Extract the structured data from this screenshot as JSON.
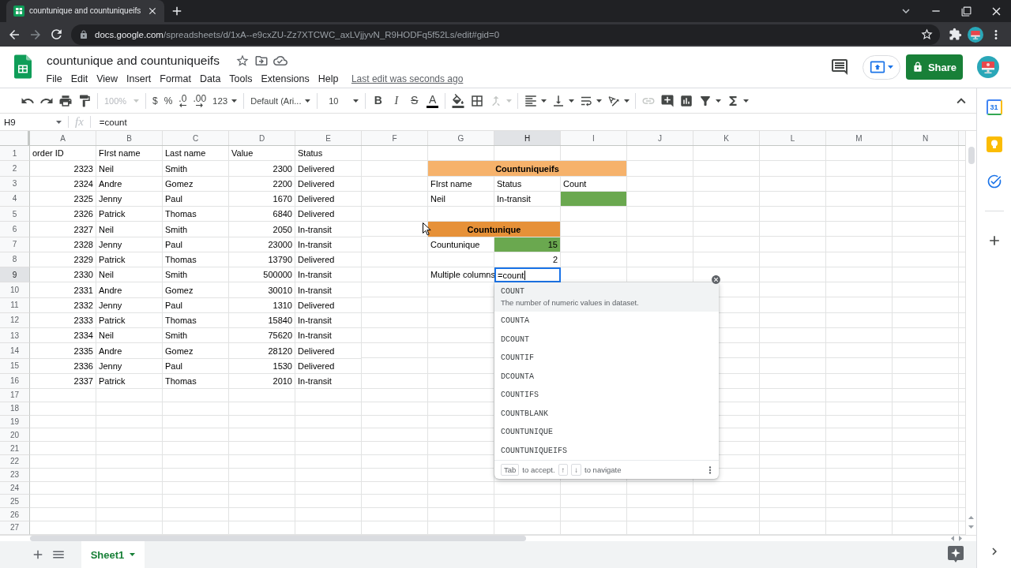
{
  "browser": {
    "tab": {
      "title": "countunique and countuniqueifs"
    },
    "url": {
      "host": "docs.google.com",
      "path": "/spreadsheets/d/1xA--e9cxZU-Zz7XTCWC_axLVjjyvN_R9HODFq5f52Ls/edit#gid=0"
    }
  },
  "document": {
    "title": "countunique and countuniqueifs",
    "menu": [
      "File",
      "Edit",
      "View",
      "Insert",
      "Format",
      "Data",
      "Tools",
      "Extensions",
      "Help"
    ],
    "last_edit": "Last edit was seconds ago",
    "share_button": "Share"
  },
  "toolbar": {
    "zoom": {
      "label": "100%",
      "disabled": true
    },
    "number_formats": [
      {
        "label": "$",
        "kind": "plain"
      },
      {
        "label": "%",
        "kind": "plain"
      },
      {
        "label": ".0",
        "kind": "decrease"
      },
      {
        "label": ".00",
        "kind": "increase"
      },
      {
        "label": "123",
        "kind": "menu"
      }
    ],
    "font": "Default (Ari...",
    "font_size": "10",
    "text_styles": [
      {
        "label": "B",
        "kind": "bold"
      },
      {
        "label": "I",
        "kind": "italic"
      },
      {
        "label": "S",
        "kind": "strike"
      },
      {
        "label": "A",
        "kind": "color"
      }
    ]
  },
  "formula_bar": {
    "cell_ref": "H9",
    "fx": "fx",
    "formula": "=count"
  },
  "sheet": {
    "columns": [
      {
        "label": "A",
        "selected": false
      },
      {
        "label": "B",
        "selected": false
      },
      {
        "label": "C",
        "selected": false
      },
      {
        "label": "D",
        "selected": false
      },
      {
        "label": "E",
        "selected": false
      },
      {
        "label": "F",
        "selected": false
      },
      {
        "label": "G",
        "selected": false
      },
      {
        "label": "H",
        "selected": true
      },
      {
        "label": "I",
        "selected": false
      },
      {
        "label": "J",
        "selected": false
      },
      {
        "label": "K",
        "selected": false
      },
      {
        "label": "L",
        "selected": false
      },
      {
        "label": "M",
        "selected": false
      },
      {
        "label": "N",
        "selected": false
      }
    ],
    "rows": [
      {
        "number": "1",
        "selected": false,
        "cells": [
          {
            "kind": "text",
            "text": "order ID"
          },
          {
            "kind": "text",
            "text": "FIrst name"
          },
          {
            "kind": "text",
            "text": "Last name"
          },
          {
            "kind": "text",
            "text": "Value"
          },
          {
            "kind": "text",
            "text": "Status"
          }
        ]
      },
      {
        "number": "2",
        "selected": false,
        "cells": [
          {
            "kind": "number",
            "text": "2323"
          },
          {
            "kind": "text",
            "text": "Neil"
          },
          {
            "kind": "text",
            "text": "Smith"
          },
          {
            "kind": "number",
            "text": "2300"
          },
          {
            "kind": "text",
            "text": "Delivered"
          },
          {
            "kind": "blank"
          },
          {
            "kind": "heading",
            "text": "Countuniqueifs",
            "color": "#f6b26b"
          },
          {
            "kind": "merged"
          },
          {
            "kind": "merged"
          }
        ]
      },
      {
        "number": "3",
        "selected": false,
        "cells": [
          {
            "kind": "number",
            "text": "2324"
          },
          {
            "kind": "text",
            "text": "Andre"
          },
          {
            "kind": "text",
            "text": "Gomez"
          },
          {
            "kind": "number",
            "text": "2200"
          },
          {
            "kind": "text",
            "text": "Delivered"
          },
          {
            "kind": "blank"
          },
          {
            "kind": "text",
            "text": "FIrst name"
          },
          {
            "kind": "text",
            "text": "Status"
          },
          {
            "kind": "text",
            "text": "Count"
          }
        ]
      },
      {
        "number": "4",
        "selected": false,
        "cells": [
          {
            "kind": "number",
            "text": "2325"
          },
          {
            "kind": "text",
            "text": "Jenny"
          },
          {
            "kind": "text",
            "text": "Paul"
          },
          {
            "kind": "number",
            "text": "1670"
          },
          {
            "kind": "text",
            "text": "Delivered"
          },
          {
            "kind": "blank"
          },
          {
            "kind": "text",
            "text": "Neil"
          },
          {
            "kind": "text",
            "text": "In-transit"
          },
          {
            "kind": "fill",
            "color": "#6aa84f"
          }
        ]
      },
      {
        "number": "5",
        "selected": false,
        "cells": [
          {
            "kind": "number",
            "text": "2326"
          },
          {
            "kind": "text",
            "text": "Patrick"
          },
          {
            "kind": "text",
            "text": "Thomas"
          },
          {
            "kind": "number",
            "text": "6840"
          },
          {
            "kind": "text",
            "text": "Delivered"
          }
        ]
      },
      {
        "number": "6",
        "selected": false,
        "cells": [
          {
            "kind": "number",
            "text": "2327"
          },
          {
            "kind": "text",
            "text": "Neil"
          },
          {
            "kind": "text",
            "text": "Smith"
          },
          {
            "kind": "number",
            "text": "2050"
          },
          {
            "kind": "text",
            "text": "In-transit"
          },
          {
            "kind": "blank"
          },
          {
            "kind": "heading",
            "text": "Countunique",
            "color": "#e69138"
          },
          {
            "kind": "merged"
          }
        ]
      },
      {
        "number": "7",
        "selected": false,
        "cells": [
          {
            "kind": "number",
            "text": "2328"
          },
          {
            "kind": "text",
            "text": "Jenny"
          },
          {
            "kind": "text",
            "text": "Paul"
          },
          {
            "kind": "number",
            "text": "23000"
          },
          {
            "kind": "text",
            "text": "In-transit"
          },
          {
            "kind": "blank"
          },
          {
            "kind": "text",
            "text": "Countunique"
          },
          {
            "kind": "number",
            "text": "15",
            "color": "#6aa84f"
          }
        ]
      },
      {
        "number": "8",
        "selected": false,
        "cells": [
          {
            "kind": "number",
            "text": "2329"
          },
          {
            "kind": "text",
            "text": "Patrick"
          },
          {
            "kind": "text",
            "text": "Thomas"
          },
          {
            "kind": "number",
            "text": "13790"
          },
          {
            "kind": "text",
            "text": "Delivered"
          },
          {
            "kind": "blank"
          },
          {
            "kind": "blank"
          },
          {
            "kind": "number",
            "text": "2"
          }
        ]
      },
      {
        "number": "9",
        "selected": true,
        "cells": [
          {
            "kind": "number",
            "text": "2330"
          },
          {
            "kind": "text",
            "text": "Neil"
          },
          {
            "kind": "text",
            "text": "Smith"
          },
          {
            "kind": "number",
            "text": "500000"
          },
          {
            "kind": "text",
            "text": "In-transit"
          },
          {
            "kind": "blank"
          },
          {
            "kind": "text",
            "text": "Multiple columns"
          },
          {
            "kind": "editor",
            "text": "=count"
          }
        ]
      },
      {
        "number": "10",
        "selected": false,
        "cells": [
          {
            "kind": "number",
            "text": "2331"
          },
          {
            "kind": "text",
            "text": "Andre"
          },
          {
            "kind": "text",
            "text": "Gomez"
          },
          {
            "kind": "number",
            "text": "30010"
          },
          {
            "kind": "text",
            "text": "In-transit"
          }
        ]
      },
      {
        "number": "11",
        "selected": false,
        "cells": [
          {
            "kind": "number",
            "text": "2332"
          },
          {
            "kind": "text",
            "text": "Jenny"
          },
          {
            "kind": "text",
            "text": "Paul"
          },
          {
            "kind": "number",
            "text": "1310"
          },
          {
            "kind": "text",
            "text": "Delivered"
          }
        ]
      },
      {
        "number": "12",
        "selected": false,
        "cells": [
          {
            "kind": "number",
            "text": "2333"
          },
          {
            "kind": "text",
            "text": "Patrick"
          },
          {
            "kind": "text",
            "text": "Thomas"
          },
          {
            "kind": "number",
            "text": "15840"
          },
          {
            "kind": "text",
            "text": "In-transit"
          }
        ]
      },
      {
        "number": "13",
        "selected": false,
        "cells": [
          {
            "kind": "number",
            "text": "2334"
          },
          {
            "kind": "text",
            "text": "Neil"
          },
          {
            "kind": "text",
            "text": "Smith"
          },
          {
            "kind": "number",
            "text": "75620"
          },
          {
            "kind": "text",
            "text": "In-transit"
          }
        ]
      },
      {
        "number": "14",
        "selected": false,
        "cells": [
          {
            "kind": "number",
            "text": "2335"
          },
          {
            "kind": "text",
            "text": "Andre"
          },
          {
            "kind": "text",
            "text": "Gomez"
          },
          {
            "kind": "number",
            "text": "28120"
          },
          {
            "kind": "text",
            "text": "Delivered"
          }
        ]
      },
      {
        "number": "15",
        "selected": false,
        "cells": [
          {
            "kind": "number",
            "text": "2336"
          },
          {
            "kind": "text",
            "text": "Jenny"
          },
          {
            "kind": "text",
            "text": "Paul"
          },
          {
            "kind": "number",
            "text": "1530"
          },
          {
            "kind": "text",
            "text": "Delivered"
          }
        ]
      },
      {
        "number": "16",
        "selected": false,
        "cells": [
          {
            "kind": "number",
            "text": "2337"
          },
          {
            "kind": "text",
            "text": "Patrick"
          },
          {
            "kind": "text",
            "text": "Thomas"
          },
          {
            "kind": "number",
            "text": "2010"
          },
          {
            "kind": "text",
            "text": "In-transit"
          }
        ]
      },
      {
        "number": "17",
        "selected": false
      },
      {
        "number": "18",
        "selected": false
      },
      {
        "number": "19",
        "selected": false
      },
      {
        "number": "20",
        "selected": false
      },
      {
        "number": "21",
        "selected": false
      },
      {
        "number": "22",
        "selected": false
      },
      {
        "number": "23",
        "selected": false
      },
      {
        "number": "24",
        "selected": false
      },
      {
        "number": "25",
        "selected": false
      },
      {
        "number": "26",
        "selected": false
      },
      {
        "number": "27",
        "selected": false
      }
    ]
  },
  "autocomplete": {
    "items": [
      {
        "name": "COUNT",
        "description": "The number of numeric values in dataset.",
        "selected": true
      },
      {
        "name": "COUNTA",
        "selected": false
      },
      {
        "name": "DCOUNT",
        "selected": false
      },
      {
        "name": "COUNTIF",
        "selected": false
      },
      {
        "name": "DCOUNTA",
        "selected": false
      },
      {
        "name": "COUNTIFS",
        "selected": false
      },
      {
        "name": "COUNTBLANK",
        "selected": false
      },
      {
        "name": "COUNTUNIQUE",
        "selected": false
      },
      {
        "name": "COUNTUNIQUEIFS",
        "selected": false
      }
    ],
    "footer": {
      "accept_key": "Tab",
      "accept_text": "to accept.",
      "navigate_keys": [
        "↑",
        "↓"
      ],
      "navigate_text": "to navigate"
    }
  },
  "sheet_tabs": [
    {
      "label": "Sheet1",
      "selected": true
    }
  ],
  "side_panel": {
    "calendar_day": "31"
  }
}
